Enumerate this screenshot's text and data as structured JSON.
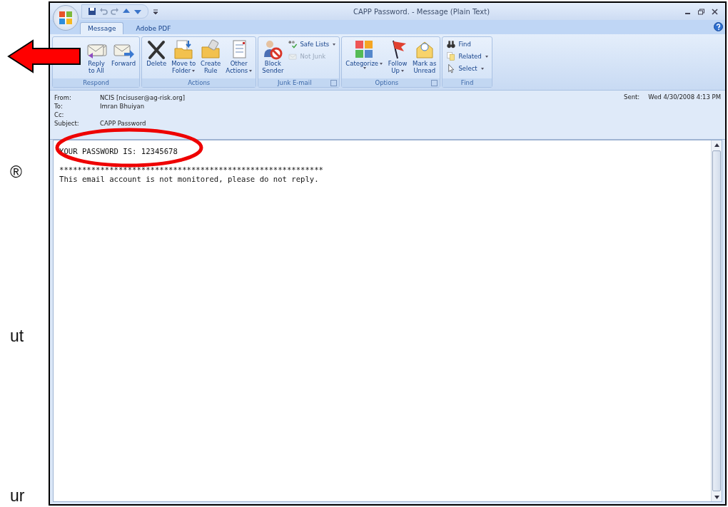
{
  "slide_fragments": [
    "®",
    "ut",
    "ur"
  ],
  "window": {
    "title": "CAPP Password. - Message (Plain Text)"
  },
  "tabs": [
    {
      "label": "Message",
      "selected": true
    },
    {
      "label": "Adobe PDF",
      "selected": false
    }
  ],
  "ribbon_groups": [
    {
      "label": "Respond",
      "launcher": false,
      "buttons": [
        {
          "kind": "large",
          "lines": [
            "Reply",
            "to All"
          ],
          "dropdown": false,
          "disabled": false
        },
        {
          "kind": "large",
          "lines": [
            "Forward"
          ],
          "dropdown": false,
          "disabled": false
        }
      ]
    },
    {
      "label": "Actions",
      "launcher": false,
      "buttons": [
        {
          "kind": "large",
          "lines": [
            "Delete"
          ],
          "dropdown": false,
          "disabled": false
        },
        {
          "kind": "large",
          "lines": [
            "Move to",
            "Folder"
          ],
          "dropdown": true,
          "disabled": false
        },
        {
          "kind": "large",
          "lines": [
            "Create",
            "Rule"
          ],
          "dropdown": false,
          "disabled": false
        },
        {
          "kind": "large",
          "lines": [
            "Other",
            "Actions"
          ],
          "dropdown": true,
          "disabled": false
        }
      ]
    },
    {
      "label": "Junk E-mail",
      "launcher": true,
      "buttons": [
        {
          "kind": "large",
          "lines": [
            "Block",
            "Sender"
          ],
          "dropdown": false,
          "disabled": false
        },
        {
          "kind": "small",
          "lines": [
            "Safe Lists"
          ],
          "dropdown": true,
          "disabled": false
        },
        {
          "kind": "small",
          "lines": [
            "Not Junk"
          ],
          "dropdown": false,
          "disabled": true
        }
      ]
    },
    {
      "label": "Options",
      "launcher": true,
      "buttons": [
        {
          "kind": "large",
          "lines": [
            "Categorize"
          ],
          "dropdown": true,
          "disabled": false
        },
        {
          "kind": "large",
          "lines": [
            "Follow",
            "Up"
          ],
          "dropdown": true,
          "disabled": false
        },
        {
          "kind": "large",
          "lines": [
            "Mark as",
            "Unread"
          ],
          "dropdown": false,
          "disabled": false
        }
      ]
    },
    {
      "label": "Find",
      "launcher": false,
      "buttons": [
        {
          "kind": "small",
          "lines": [
            "Find"
          ],
          "dropdown": false,
          "disabled": false
        },
        {
          "kind": "small",
          "lines": [
            "Related"
          ],
          "dropdown": true,
          "disabled": false
        },
        {
          "kind": "small",
          "lines": [
            "Select"
          ],
          "dropdown": true,
          "disabled": false
        }
      ]
    }
  ],
  "header": {
    "fields": [
      {
        "label": "From:",
        "value": "NCIS [ncisuser@ag-risk.org]"
      },
      {
        "label": "To:",
        "value": "Imran Bhuiyan"
      },
      {
        "label": "Cc:"
      },
      {
        "label": "Subject:",
        "value": "CAPP Password"
      }
    ],
    "sent": {
      "label": "Sent:",
      "value": "Wed 4/30/2008 4:13 PM"
    }
  },
  "body": {
    "password_line": "YOUR PASSWORD IS: 12345678",
    "separator": "**********************************************************",
    "notice": "This email account is not monitored, please do not reply."
  }
}
